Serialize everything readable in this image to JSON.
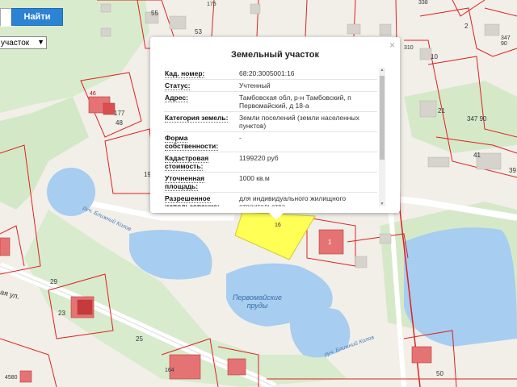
{
  "search": {
    "button_label": "Найти"
  },
  "layer_select": {
    "value": "участок"
  },
  "map_labels": {
    "parcel_55": "55",
    "parcel_53": "53",
    "parcel_175": "175",
    "parcel_338": "338",
    "parcel_2": "2",
    "parcel_310": "310",
    "parcel_10": "10",
    "parcel_347_90_top": "347\n90",
    "parcel_21": "21",
    "parcel_347_90": "347 90",
    "parcel_41": "41",
    "parcel_39": "39",
    "parcel_46": "46",
    "parcel_177": "177",
    "parcel_48": "48",
    "parcel_19": "19",
    "parcel_16": "16",
    "parcel_1": "1",
    "parcel_29": "29",
    "parcel_23": "23",
    "parcel_25": "25",
    "parcel_164": "164",
    "parcel_4580": "4580",
    "parcel_50": "50",
    "street_ul": "ая ул.",
    "stream_label_1": "руч. Ближний Колов",
    "stream_label_2": "руч. Ближний Колов",
    "ponds_label": "Первомайские\nпруды"
  },
  "popup": {
    "title": "Земельный участок",
    "close": "×",
    "rows": [
      {
        "label": "Кад. номер:",
        "value": "68:20:3005001:16"
      },
      {
        "label": "Статус:",
        "value": "Учтенный"
      },
      {
        "label": "Адрес:",
        "value": "Тамбовская обл, р-н Тамбовский, п Первомайский, д 18-а"
      },
      {
        "label": "Категория земель:",
        "value": "Земли поселений (земли населенных пунктов)"
      },
      {
        "label": "Форма собственности:",
        "value": "-"
      },
      {
        "label": "Кадастровая стоимость:",
        "value": "1199220 руб"
      },
      {
        "label": "Уточненная площадь:",
        "value": "1000 кв.м"
      },
      {
        "label": "Разрешенное использование:",
        "value": "для индивидуального жилищного строительства"
      }
    ]
  },
  "colors": {
    "accent": "#2d83d3",
    "parcel_border": "#d22",
    "selected_parcel": "#ffff55",
    "water": "#a7cdf0",
    "park": "#cfe8c4"
  }
}
